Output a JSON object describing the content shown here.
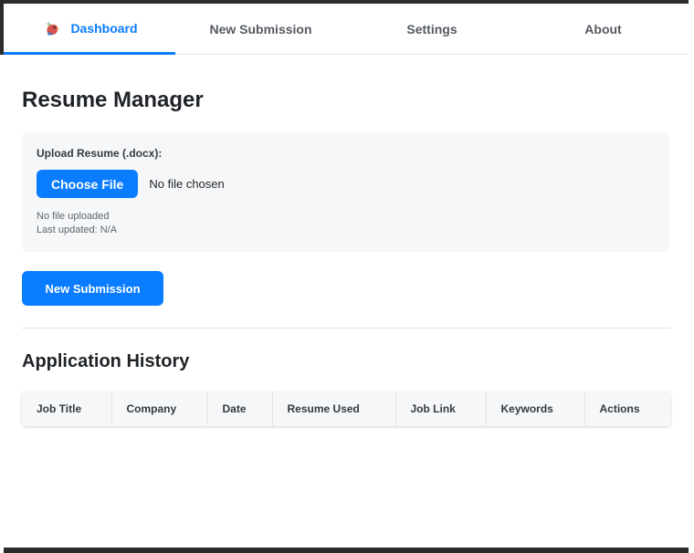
{
  "tabs": [
    {
      "label": "Dashboard",
      "active": true
    },
    {
      "label": "New Submission",
      "active": false
    },
    {
      "label": "Settings",
      "active": false
    },
    {
      "label": "About",
      "active": false
    }
  ],
  "page_title": "Resume Manager",
  "upload": {
    "label": "Upload Resume (.docx):",
    "choose_button": "Choose File",
    "file_status": "No file chosen",
    "uploaded_status": "No file uploaded",
    "last_updated": "Last updated: N/A"
  },
  "new_submission_button": "New Submission",
  "history": {
    "title": "Application History",
    "columns": [
      "Job Title",
      "Company",
      "Date",
      "Resume Used",
      "Job Link",
      "Keywords",
      "Actions"
    ]
  },
  "colors": {
    "accent": "#0a7cff",
    "card_bg": "#f6f7f8",
    "text": "#1f2327"
  },
  "icons": {
    "logo": "bird-logo-icon"
  }
}
